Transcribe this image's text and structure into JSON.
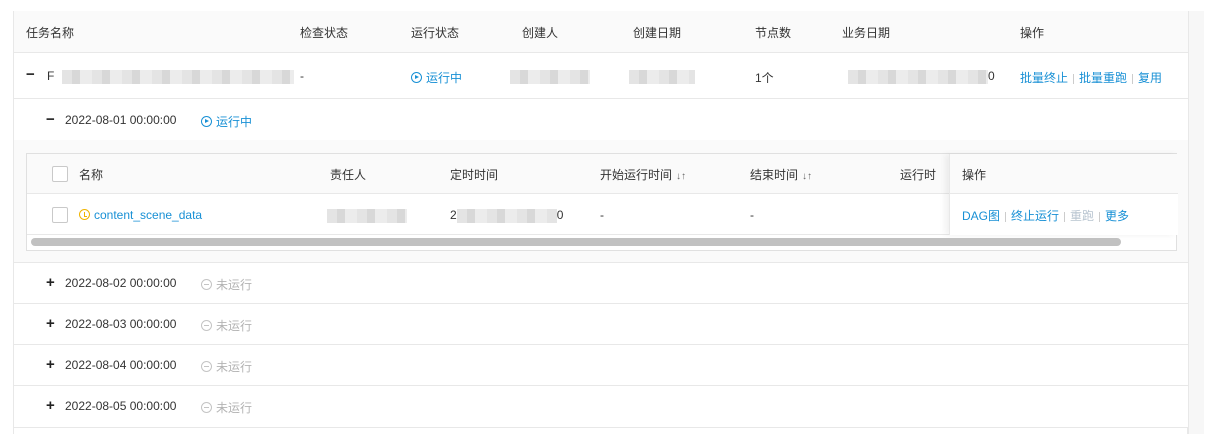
{
  "columns": [
    "任务名称",
    "检查状态",
    "运行状态",
    "创建人",
    "创建日期",
    "节点数",
    "业务日期",
    "操作"
  ],
  "task": {
    "name_visible": "F",
    "check_status": "-",
    "run_status": "运行中",
    "node_count": "1个",
    "biz_date_tail": "0",
    "actions": [
      "批量终止",
      "批量重跑",
      "复用"
    ]
  },
  "instances": [
    {
      "date": "2022-08-01 00:00:00",
      "status": "运行中",
      "expanded": true
    },
    {
      "date": "2022-08-02 00:00:00",
      "status": "未运行",
      "expanded": false
    },
    {
      "date": "2022-08-03 00:00:00",
      "status": "未运行",
      "expanded": false
    },
    {
      "date": "2022-08-04 00:00:00",
      "status": "未运行",
      "expanded": false
    },
    {
      "date": "2022-08-05 00:00:00",
      "status": "未运行",
      "expanded": false
    }
  ],
  "subtable": {
    "columns": [
      "名称",
      "责任人",
      "定时时间",
      "开始运行时间",
      "结束时间",
      "运行时",
      "操作"
    ],
    "row": {
      "name": "content_scene_data",
      "sched_head": "2",
      "sched_tail": "0",
      "start": "-",
      "end": "-",
      "actions": [
        "DAG图",
        "终止运行",
        "重跑",
        "更多"
      ]
    }
  },
  "icons": {
    "expanded": "minus-icon",
    "collapsed": "plus-icon",
    "running": "play-circle-icon",
    "idle": "minus-circle-icon",
    "schedule": "clock-icon",
    "sort": "sort-icon"
  },
  "colors": {
    "link": "#1890d5",
    "idle": "#b3b3b3",
    "clock": "#f0b400"
  }
}
